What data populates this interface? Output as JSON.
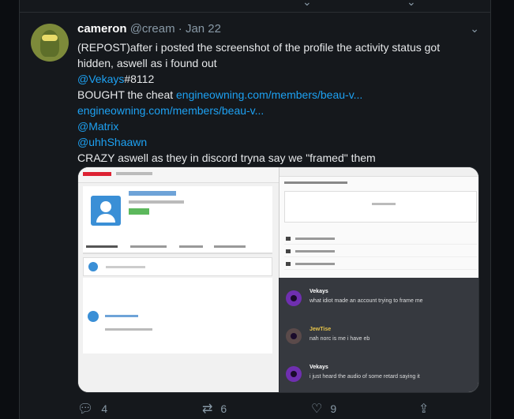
{
  "tweet": {
    "author_name": "cameron",
    "author_handle": "@cream",
    "separator": "·",
    "date": "Jan 22",
    "lines": [
      {
        "parts": [
          {
            "text": "(REPOST)after i posted the screenshot of the profile the activity status got",
            "link": false
          }
        ]
      },
      {
        "parts": [
          {
            "text": "hidden, aswell as i found out",
            "link": false
          }
        ]
      },
      {
        "parts": [
          {
            "text": "@Vekays",
            "link": true
          },
          {
            "text": "#8112",
            "link": false
          }
        ]
      },
      {
        "parts": [
          {
            "text": " BOUGHT the cheat ",
            "link": false
          },
          {
            "text": "engineowning.com/members/beau-v...",
            "link": true
          }
        ]
      },
      {
        "parts": [
          {
            "text": "engineowning.com/members/beau-v...",
            "link": true
          }
        ]
      },
      {
        "parts": [
          {
            "text": "@Matrix",
            "link": true
          }
        ]
      },
      {
        "parts": [
          {
            "text": " @uhhShaawn",
            "link": true
          }
        ]
      },
      {
        "parts": [
          {
            "text": " CRAZY aswell as they in discord tryna say we \"framed\" them",
            "link": false
          }
        ]
      }
    ]
  },
  "media": {
    "discord_messages": [
      {
        "user": "Vekays",
        "text": "what idiot made an account trying to frame me",
        "user_color": "#ffffff"
      },
      {
        "user": "JewTise",
        "text": "nah norc is me i have eb",
        "user_color": "#e6c34a"
      },
      {
        "user": "Vekays",
        "text": "i just heard the audio of some retard saying it",
        "user_color": "#ffffff"
      }
    ]
  },
  "actions": {
    "reply_icon": "reply-icon",
    "reply_count": "4",
    "retweet_icon": "retweet-icon",
    "retweet_count": "6",
    "like_icon": "heart-icon",
    "like_count": "9",
    "share_icon": "share-icon"
  },
  "colors": {
    "link": "#1da1f2",
    "background": "#15181c",
    "muted": "#8899a6"
  }
}
